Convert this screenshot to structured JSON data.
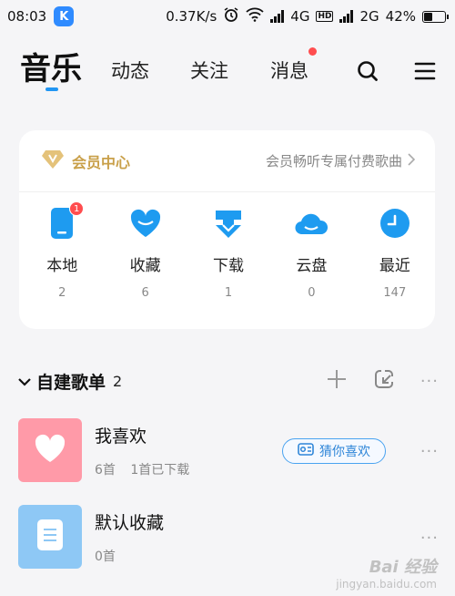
{
  "status_bar": {
    "time": "08:03",
    "app_badge": "K",
    "speed": "0.37K/s",
    "net1": "4G",
    "hd": "HD",
    "net2": "2G",
    "battery_text": "42%",
    "battery_level": 0.42
  },
  "nav": {
    "tabs": [
      {
        "label": "音乐"
      },
      {
        "label": "动态"
      },
      {
        "label": "关注"
      },
      {
        "label": "消息"
      }
    ],
    "icons": [
      "search-icon",
      "menu-icon"
    ]
  },
  "vip": {
    "label": "会员中心",
    "promo": "会员畅听专属付费歌曲",
    "icon": "vip-diamond-icon",
    "accent": "#d8b15c"
  },
  "shortcuts": [
    {
      "label": "本地",
      "count": "2",
      "badge": "1",
      "icon": "phone-icon"
    },
    {
      "label": "收藏",
      "count": "6",
      "icon": "heart-icon"
    },
    {
      "label": "下载",
      "count": "1",
      "icon": "download-icon"
    },
    {
      "label": "云盘",
      "count": "0",
      "icon": "cloud-icon"
    },
    {
      "label": "最近",
      "count": "147",
      "icon": "clock-icon"
    }
  ],
  "playlists_section": {
    "title": "自建歌单",
    "count": "2",
    "actions": [
      "add-icon",
      "import-icon",
      "more-icon"
    ]
  },
  "playlists": [
    {
      "name": "我喜欢",
      "songs": "6首",
      "downloaded": "1首已下载",
      "action_label": "猜你喜欢",
      "cover_color": "#ff9aa8",
      "icon": "heart-icon"
    },
    {
      "name": "默认收藏",
      "songs": "0首",
      "cover_color": "#8ec8f5",
      "icon": "document-icon"
    }
  ],
  "colors": {
    "primary": "#2196f3",
    "badge_red": "#ff4d4f"
  },
  "watermark": {
    "main": "Bai 经验",
    "sub": "jingyan.baidu.com"
  }
}
